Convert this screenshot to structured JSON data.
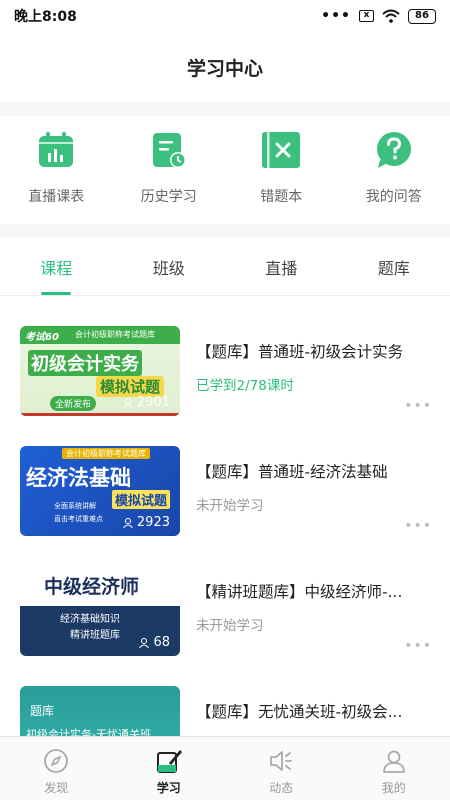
{
  "status_bar": {
    "time": "晚上8:08",
    "signal_dots": "•••",
    "sim": "x",
    "battery": "86"
  },
  "header": {
    "title": "学习中心"
  },
  "quick_entries": [
    {
      "label": "直播课表",
      "icon": "calendar-chart-icon"
    },
    {
      "label": "历史学习",
      "icon": "history-doc-icon"
    },
    {
      "label": "错题本",
      "icon": "wrong-book-icon"
    },
    {
      "label": "我的问答",
      "icon": "question-bubble-icon"
    }
  ],
  "tabs": [
    {
      "label": "课程",
      "active": true
    },
    {
      "label": "班级"
    },
    {
      "label": "直播"
    },
    {
      "label": "题库"
    }
  ],
  "courses": [
    {
      "title": "【题库】普通班-初级会计实务",
      "progress": "已学到2/78课时",
      "thumb": {
        "brand": "考试60",
        "header": "会计初级职称考试题库",
        "line1": "初级会计实务",
        "line2": "模拟试题",
        "badge": "全新发布",
        "count": "2901"
      }
    },
    {
      "title": "【题库】普通班-经济法基础",
      "progress": "未开始学习",
      "thumb": {
        "header": "会计初级职称考试题库",
        "line1": "经济法基础",
        "line2": "模拟试题",
        "badge1": "全面系统讲解",
        "badge2": "直击考试重难点",
        "count": "2923"
      }
    },
    {
      "title": "【精讲班题库】中级经济师-...",
      "progress": "未开始学习",
      "thumb": {
        "line1": "中级经济师",
        "line2": "经济基础知识",
        "line3": "精讲班题库",
        "count": "68"
      }
    },
    {
      "title": "【题库】无忧通关班-初级会...",
      "progress": "",
      "thumb": {
        "line1": "题库",
        "line2": "初级会计实务-无忧通关班"
      }
    }
  ],
  "more_label": "•••",
  "bottom_nav": [
    {
      "label": "发现",
      "icon": "compass-icon"
    },
    {
      "label": "学习",
      "icon": "study-icon",
      "active": true
    },
    {
      "label": "动态",
      "icon": "speaker-icon"
    },
    {
      "label": "我的",
      "icon": "person-icon"
    }
  ],
  "colors": {
    "accent": "#2bbf7f",
    "icon_green": "#3cc07f"
  }
}
